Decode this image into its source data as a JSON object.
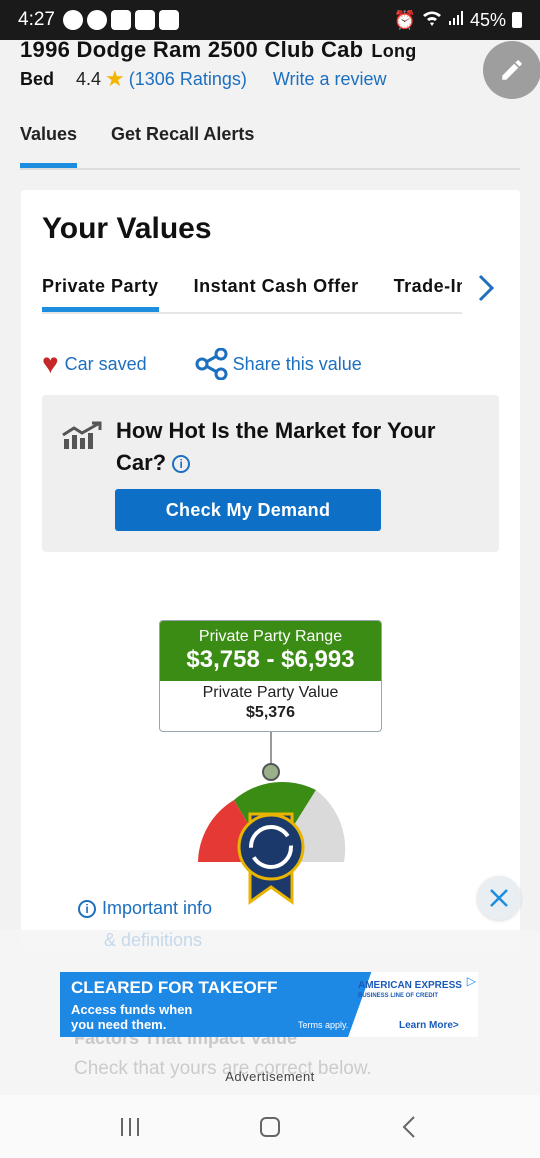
{
  "status": {
    "time": "4:27",
    "battery": "45%"
  },
  "header": {
    "title": "1996 Dodge Ram 2500 Club Cab",
    "title_cont": "Long",
    "title_line2": "Bed",
    "rating": "4.4",
    "ratings_link": "(1306 Ratings)",
    "review_link": "Write a review"
  },
  "tabs": [
    {
      "label": "Values"
    },
    {
      "label": "Get Recall Alerts"
    }
  ],
  "card": {
    "title": "Your Values",
    "subtabs": [
      {
        "label": "Private Party"
      },
      {
        "label": "Instant Cash Offer"
      },
      {
        "label": "Trade-In"
      }
    ],
    "saved": "Car saved",
    "share": "Share this value",
    "market": {
      "title": "How Hot Is the Market for Your Car?",
      "button": "Check My Demand"
    },
    "range": {
      "label": "Private Party Range",
      "value": "$3,758 - $6,993"
    },
    "value": {
      "label": "Private Party Value",
      "value": "$5,376"
    },
    "important": "Important info",
    "definitions": "& definitions"
  },
  "below": {
    "factors": "Factors That Impact Value",
    "check": "Check that yours are correct below."
  },
  "ad": {
    "headline": "CLEARED FOR TAKEOFF",
    "sub1": "Access funds when",
    "sub2": "you need them.",
    "terms": "Terms apply.",
    "brand": "AMERICAN EXPRESS",
    "brand_sub": "BUSINESS LINE OF CREDIT",
    "cta": "Learn More>",
    "label": "Advertisement"
  },
  "colors": {
    "accent": "#1d8de0",
    "link": "#1d6fbf",
    "green": "#3b8c14",
    "button": "#0e6fc7"
  }
}
